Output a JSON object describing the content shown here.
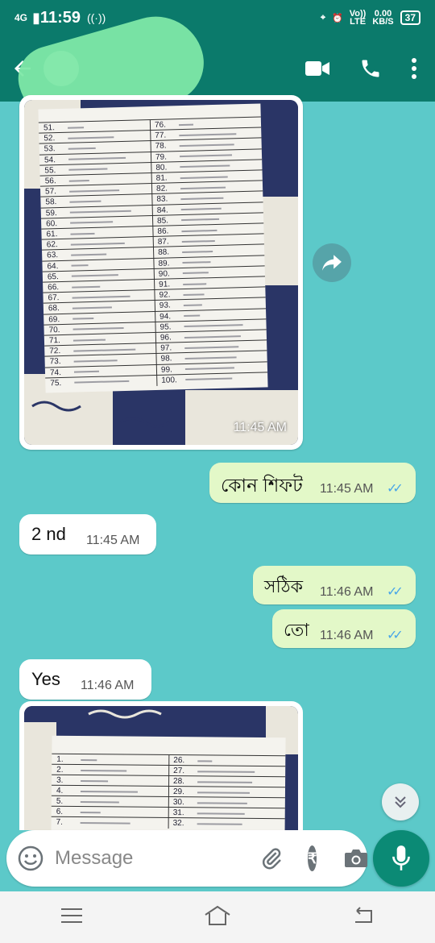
{
  "status": {
    "network": "4G",
    "time": "11:59",
    "volte_top": "Vo))",
    "volte_bottom": "LTE",
    "speed_top": "0.00",
    "speed_bottom": "KB/S",
    "battery": "37"
  },
  "header": {
    "back_icon": "arrow-left-icon",
    "video_icon": "video-camera-icon",
    "call_icon": "phone-icon",
    "menu_icon": "more-vertical-icon"
  },
  "messages": [
    {
      "type": "image",
      "direction": "in",
      "time": "11:45 AM"
    },
    {
      "type": "text",
      "direction": "out",
      "text": "কোন শিফট",
      "time": "11:45 AM"
    },
    {
      "type": "text",
      "direction": "in",
      "text": "2 nd",
      "time": "11:45 AM"
    },
    {
      "type": "text",
      "direction": "out",
      "text": "সঠিক",
      "time": "11:46 AM"
    },
    {
      "type": "text",
      "direction": "out",
      "text": "তো",
      "time": "11:46 AM"
    },
    {
      "type": "text",
      "direction": "in",
      "text": "Yes",
      "time": "11:46 AM"
    },
    {
      "type": "image",
      "direction": "in"
    }
  ],
  "sheet1": {
    "left_numbers": [
      "51.",
      "52.",
      "53.",
      "54.",
      "55.",
      "56.",
      "57.",
      "58.",
      "59.",
      "60.",
      "61.",
      "62.",
      "63.",
      "64.",
      "65.",
      "66.",
      "67.",
      "68.",
      "69.",
      "70.",
      "71.",
      "72.",
      "73.",
      "74.",
      "75."
    ],
    "right_numbers": [
      "76.",
      "77.",
      "78.",
      "79.",
      "80.",
      "81.",
      "82.",
      "83.",
      "84.",
      "85.",
      "86.",
      "87.",
      "88.",
      "89.",
      "90.",
      "91.",
      "92.",
      "93.",
      "94.",
      "95.",
      "96.",
      "97.",
      "98.",
      "99.",
      "100."
    ]
  },
  "sheet2": {
    "left_numbers": [
      "1.",
      "2.",
      "3.",
      "4.",
      "5.",
      "6.",
      "7."
    ],
    "right_numbers": [
      "26.",
      "27.",
      "28.",
      "29.",
      "30.",
      "31.",
      "32."
    ]
  },
  "composer": {
    "placeholder": "Message",
    "emoji_icon": "emoji-icon",
    "attach_icon": "paperclip-icon",
    "payment_icon": "rupee-icon",
    "camera_icon": "camera-icon",
    "mic_icon": "microphone-icon"
  },
  "colors": {
    "header": "#0b7a6b",
    "chat_background": "#5cc9c9",
    "outgoing_bubble": "#e3f8c8",
    "incoming_bubble": "#ffffff",
    "read_ticks": "#4aa6e8",
    "mic_button": "#0b8a75"
  }
}
